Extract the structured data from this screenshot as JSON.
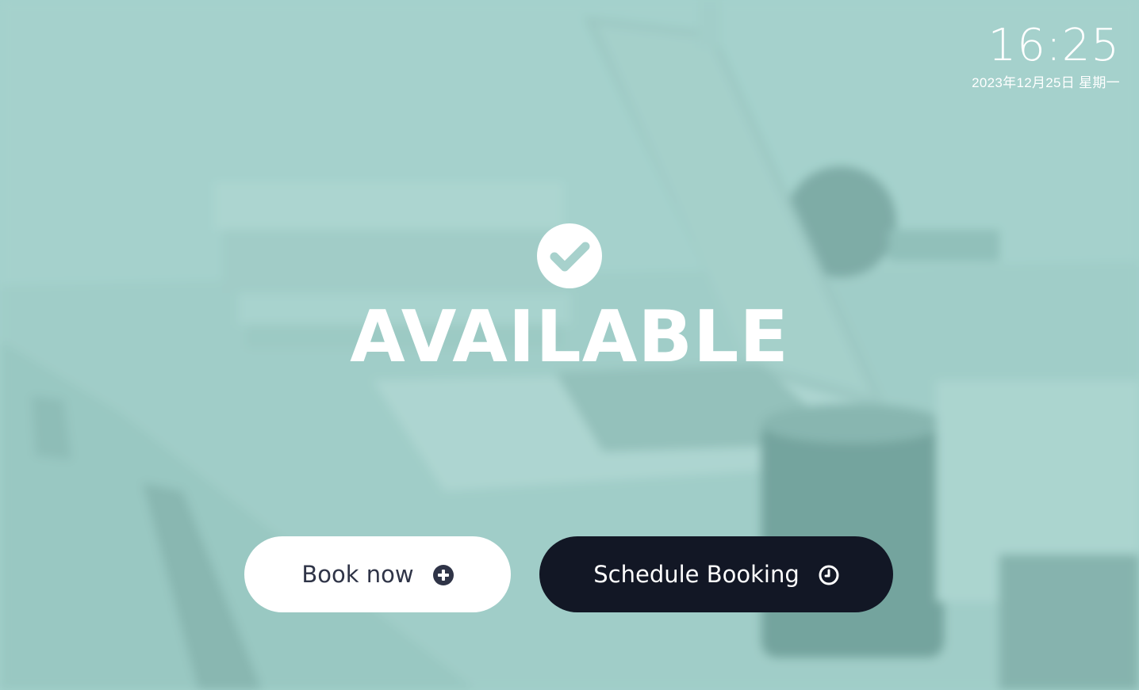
{
  "clock": {
    "time": "16:25",
    "date": "2023年12月25日 星期一"
  },
  "status": {
    "icon": "check-circle-icon",
    "text": "AVAILABLE"
  },
  "actions": {
    "book_now": {
      "label": "Book now",
      "icon": "plus-circle-icon"
    },
    "schedule": {
      "label": "Schedule Booking",
      "icon": "clock-icon"
    }
  },
  "colors": {
    "background_tint": "#a7d1cc",
    "primary_button_bg": "#ffffff",
    "primary_button_text": "#2f3447",
    "secondary_button_bg": "#121725",
    "secondary_button_text": "#ffffff",
    "foreground_text": "#ffffff"
  }
}
